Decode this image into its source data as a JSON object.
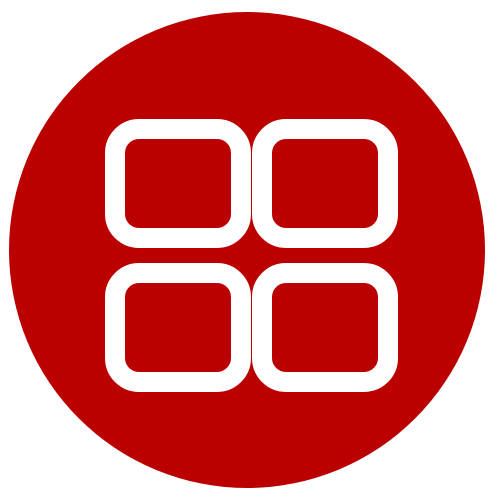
{
  "app_icon": {
    "icon": "grid-icon",
    "background_color": "#bb0000",
    "foreground_color": "#ffffff",
    "page_background": "#ffffff",
    "tiles": [
      {
        "name": "grid-tile-top-left"
      },
      {
        "name": "grid-tile-top-right"
      },
      {
        "name": "grid-tile-bottom-left"
      },
      {
        "name": "grid-tile-bottom-right"
      }
    ]
  }
}
